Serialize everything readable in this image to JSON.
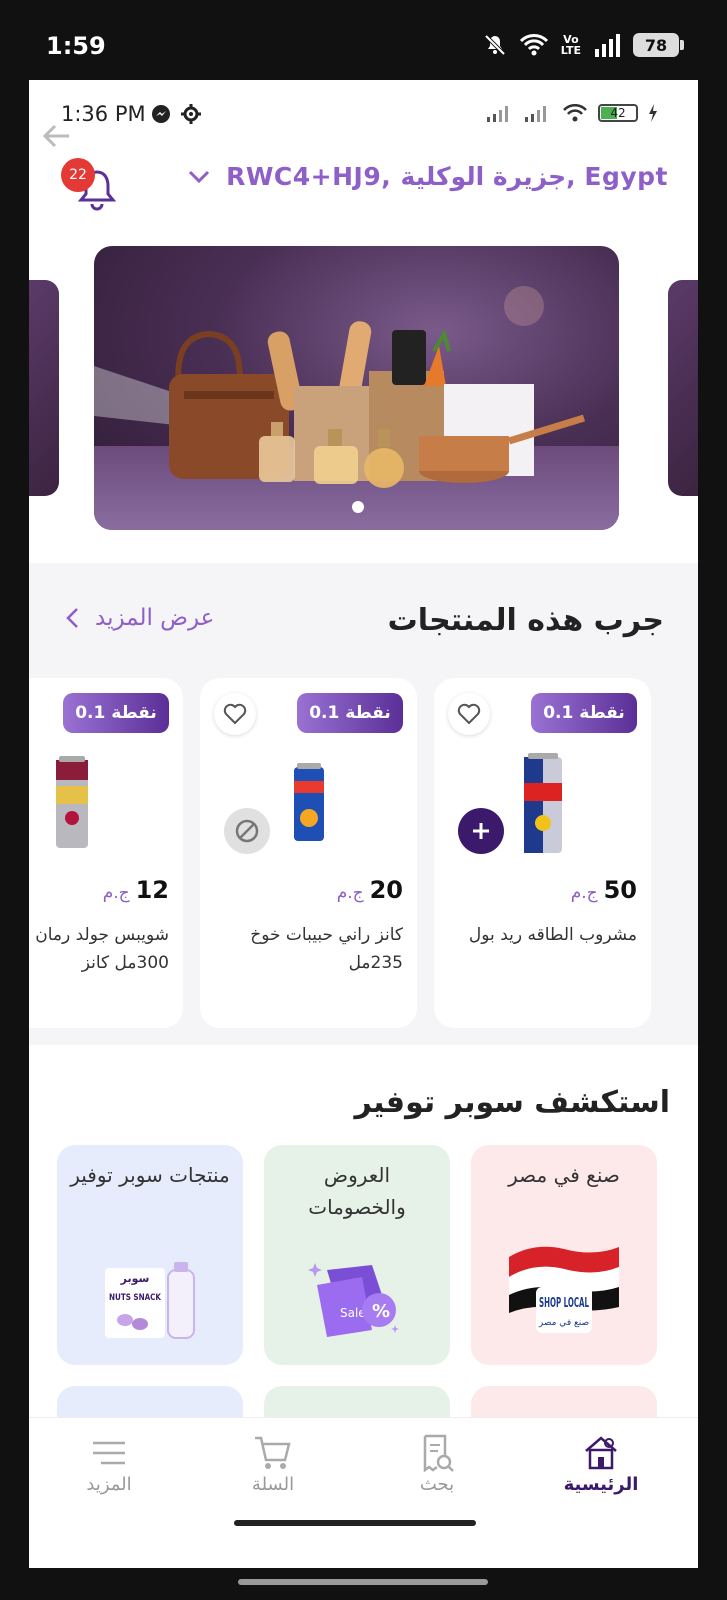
{
  "outer_status": {
    "time": "1:59",
    "volte_top": "Vo",
    "volte_bottom": "LTE",
    "battery": "78"
  },
  "inner_status": {
    "time": "1:36 PM",
    "battery": "42"
  },
  "header": {
    "notification_count": "22",
    "location": "RWC4+HJ9, جزيرة الوكلية, Egypt",
    "icons": [
      "bell-icon",
      "chevron-down-icon",
      "back-arrow-icon"
    ]
  },
  "banner": {
    "active_slide": 1,
    "slides_shown": 1
  },
  "products_section": {
    "title": "جرب هذه المنتجات",
    "see_more": "عرض المزيد",
    "products": [
      {
        "points": "0.1 نقطة",
        "price": "50",
        "currency": "ج.م",
        "name": "مشروب الطاقه ريد بول",
        "action": "add"
      },
      {
        "points": "0.1 نقطة",
        "price": "20",
        "currency": "ج.م",
        "name": "كانز راني حبيبات خوخ 235مل",
        "action": "unavailable"
      },
      {
        "points": "0.1 نقطة",
        "price": "12",
        "currency": "ج.م",
        "name": "شويبس جولد رمان 300مل كانز",
        "action": "add"
      }
    ]
  },
  "discover": {
    "title": "استكشف سوبر توفير",
    "tiles": [
      {
        "label": "صنع في مصر",
        "art_text": "SHOP LOCAL",
        "art_sub": "صنع في مصر",
        "color": "#fde8ea"
      },
      {
        "label": "العروض والخصومات",
        "art_text": "Sale",
        "art_sub": "%",
        "color": "#e6f2e8"
      },
      {
        "label": "منتجات سوبر توفير",
        "art_text": "سوبر",
        "art_sub": "NUTS SNACK",
        "color": "#e6ecfb"
      }
    ]
  },
  "bottom_nav": {
    "items": [
      {
        "label": "الرئيسية",
        "icon": "home-icon",
        "active": true
      },
      {
        "label": "بحث",
        "icon": "search-receipt-icon",
        "active": false
      },
      {
        "label": "السلة",
        "icon": "cart-icon",
        "active": false
      },
      {
        "label": "المزيد",
        "icon": "menu-icon",
        "active": false
      }
    ]
  },
  "colors": {
    "accent": "#8e5fc8",
    "primary_dark": "#3c1a6b",
    "badge": "#e53935"
  }
}
